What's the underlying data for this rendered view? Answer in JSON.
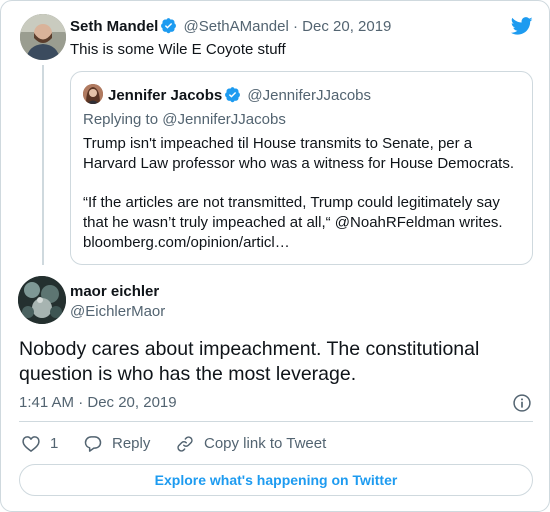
{
  "parent_tweet": {
    "name": "Seth Mandel",
    "handle": "@SethAMandel",
    "separator": "·",
    "date": "Dec 20, 2019",
    "text": "This is some Wile E Coyote stuff",
    "verified": true
  },
  "quoted_tweet": {
    "name": "Jennifer Jacobs",
    "handle": "@JenniferJJacobs",
    "verified": true,
    "replying_to": "Replying to @JenniferJJacobs",
    "paragraph1": "Trump isn't impeached til House transmits to Senate, per a Harvard Law professor who was a witness for House Democrats.",
    "paragraph2_line1": "“If the articles are not transmitted, Trump could legitimately say that he wasn’t truly impeached at all,“ @NoahRFeldman writes.",
    "paragraph2_line2": "bloomberg.com/opinion/articl…"
  },
  "main_tweet": {
    "name": "maor eichler",
    "handle": "@EichlerMaor",
    "text": "Nobody cares about impeachment. The constitutional question is who has the most leverage.",
    "timestamp": "1:41 AM · Dec 20, 2019"
  },
  "actions": {
    "like_count": "1",
    "reply_label": "Reply",
    "copy_link_label": "Copy link to Tweet"
  },
  "footer": {
    "explore_label": "Explore what's happening on Twitter"
  },
  "icons": {
    "brand": "twitter-bird-icon",
    "verified": "verified-badge-icon",
    "info": "info-icon",
    "like": "heart-icon",
    "reply": "reply-bubble-icon",
    "copy": "link-icon"
  },
  "colors": {
    "accent": "#1d9bf0",
    "text": "#0f1419",
    "muted": "#536471",
    "border": "#cfd9de"
  }
}
